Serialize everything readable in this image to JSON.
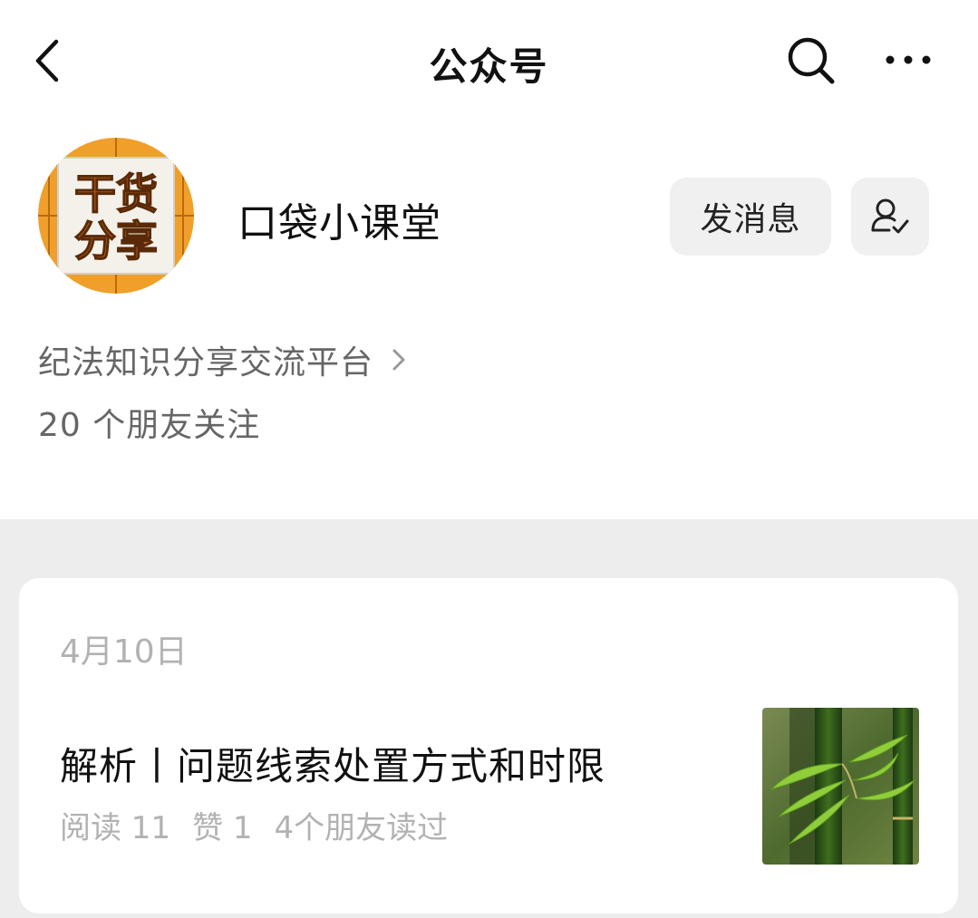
{
  "header": {
    "title": "公众号"
  },
  "account": {
    "name": "口袋小课堂",
    "avatar_text_line1": "干货",
    "avatar_text_line2": "分享",
    "message_button": "发消息",
    "description": "纪法知识分享交流平台",
    "friends_following": "20 个朋友关注"
  },
  "article": {
    "date": "4月10日",
    "title": "解析丨问题线索处置方式和时限",
    "reads": "阅读 11",
    "likes": "赞 1",
    "friends_read": "4个朋友读过"
  },
  "colors": {
    "avatar_orange": "#f0a02a",
    "page_gray": "#ededed",
    "button_gray": "#f0f0f0",
    "secondary_text": "#666666",
    "muted_text": "#b2b2b2"
  }
}
